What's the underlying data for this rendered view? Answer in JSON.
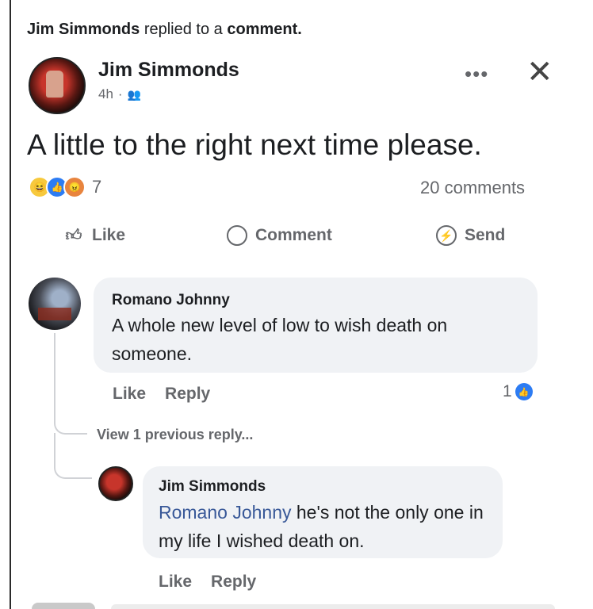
{
  "notification": {
    "actor": "Jim Simmonds",
    "action": "replied to a",
    "object": "comment."
  },
  "post": {
    "author": "Jim Simmonds",
    "time": "4h",
    "separator": "·",
    "privacy_icon": "friends-icon",
    "text": "A little to the right next time please.",
    "reaction_count": "7",
    "reaction_types": [
      "haha",
      "like",
      "angry"
    ],
    "comments_count": "20 comments"
  },
  "actions": {
    "like": "Like",
    "comment": "Comment",
    "send": "Send"
  },
  "comments": [
    {
      "author": "Romano Johnny",
      "text": "A whole new level of low to wish death on someone.",
      "like_label": "Like",
      "reply_label": "Reply",
      "reaction_count": "1"
    }
  ],
  "view_replies": "View 1 previous reply...",
  "reply": {
    "author": "Jim Simmonds",
    "mention": "Romano Johnny",
    "text": " he's not the only one in my life I wished death on.",
    "like_label": "Like",
    "reply_label": "Reply"
  },
  "colors": {
    "mention": "#385898",
    "like_blue": "#2d7cf3",
    "bubble_bg": "#f0f2f5",
    "secondary_text": "#65676b"
  }
}
